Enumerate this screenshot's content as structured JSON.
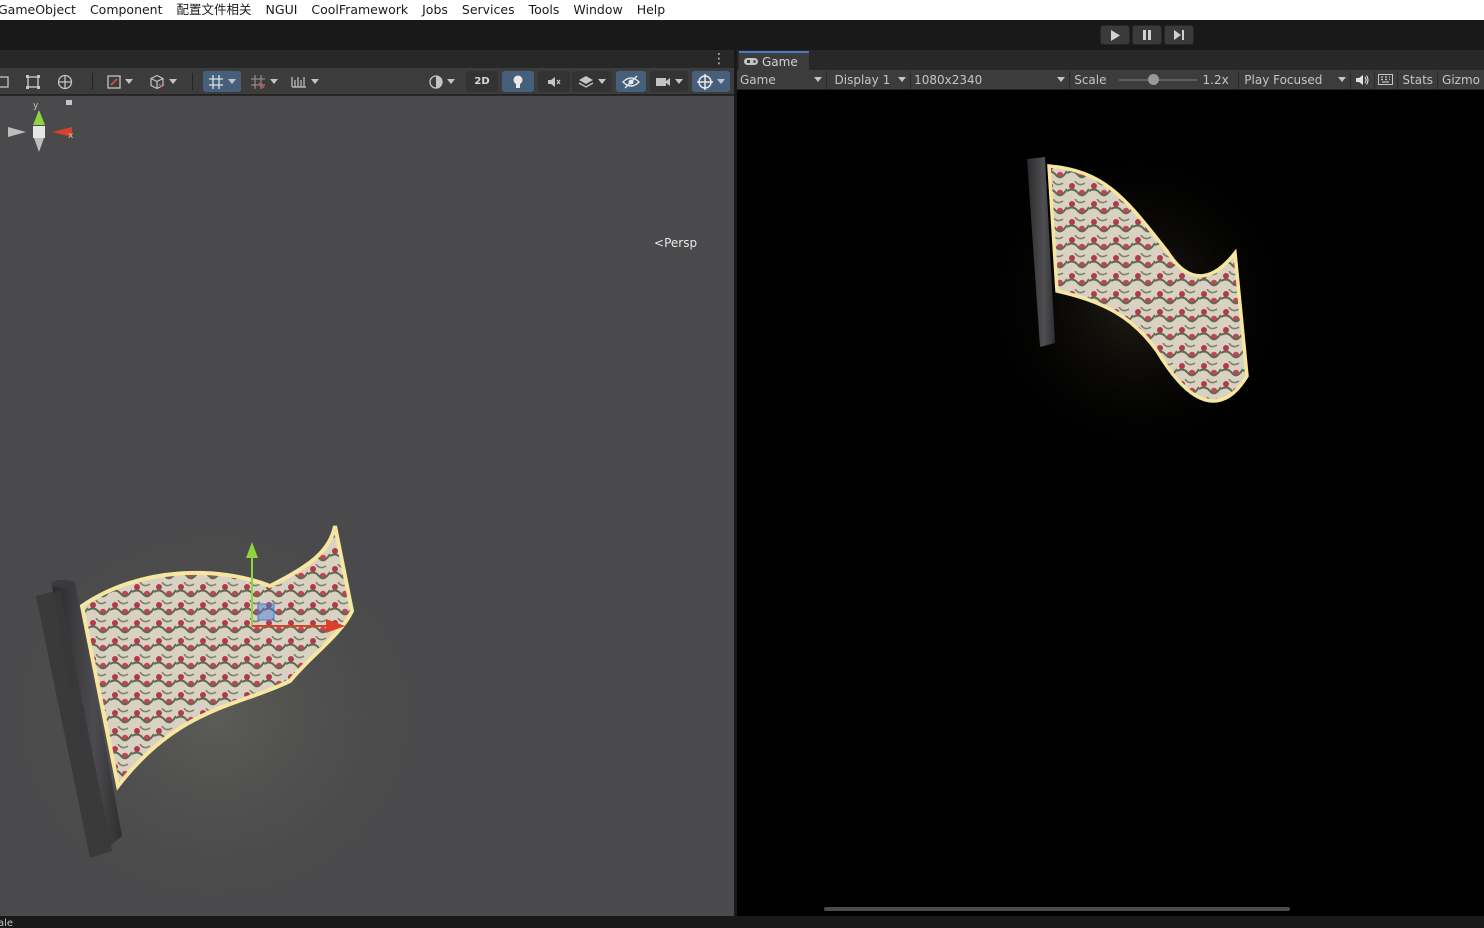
{
  "menu": [
    "GameObject",
    "Component",
    "配置文件相关",
    "NGUI",
    "CoolFramework",
    "Jobs",
    "Services",
    "Tools",
    "Window",
    "Help"
  ],
  "play_controls": {
    "play": "play-icon",
    "pause": "pause-icon",
    "step": "step-icon"
  },
  "scene": {
    "toggle_2d_label": "2D",
    "persp_label": "Persp",
    "gizmo_axes": {
      "y": "y",
      "x": "x"
    },
    "colors": {
      "background": "#4a4a4c",
      "active_button": "#46607c",
      "axis_x": "#d8412a",
      "axis_y": "#8fd43c",
      "axis_z": "#4a7ad8"
    }
  },
  "game": {
    "tab_label": "Game",
    "mode_dropdown": "Game",
    "display_dropdown": "Display 1",
    "resolution_dropdown": "1080x2340",
    "scale_label": "Scale",
    "scale_value": "1.2x",
    "scale_fraction": 0.45,
    "play_mode_dropdown": "Play Focused",
    "stats_label": "Stats",
    "gizmos_label": "Gizmo"
  },
  "bottom": {
    "status_text": "ale"
  }
}
